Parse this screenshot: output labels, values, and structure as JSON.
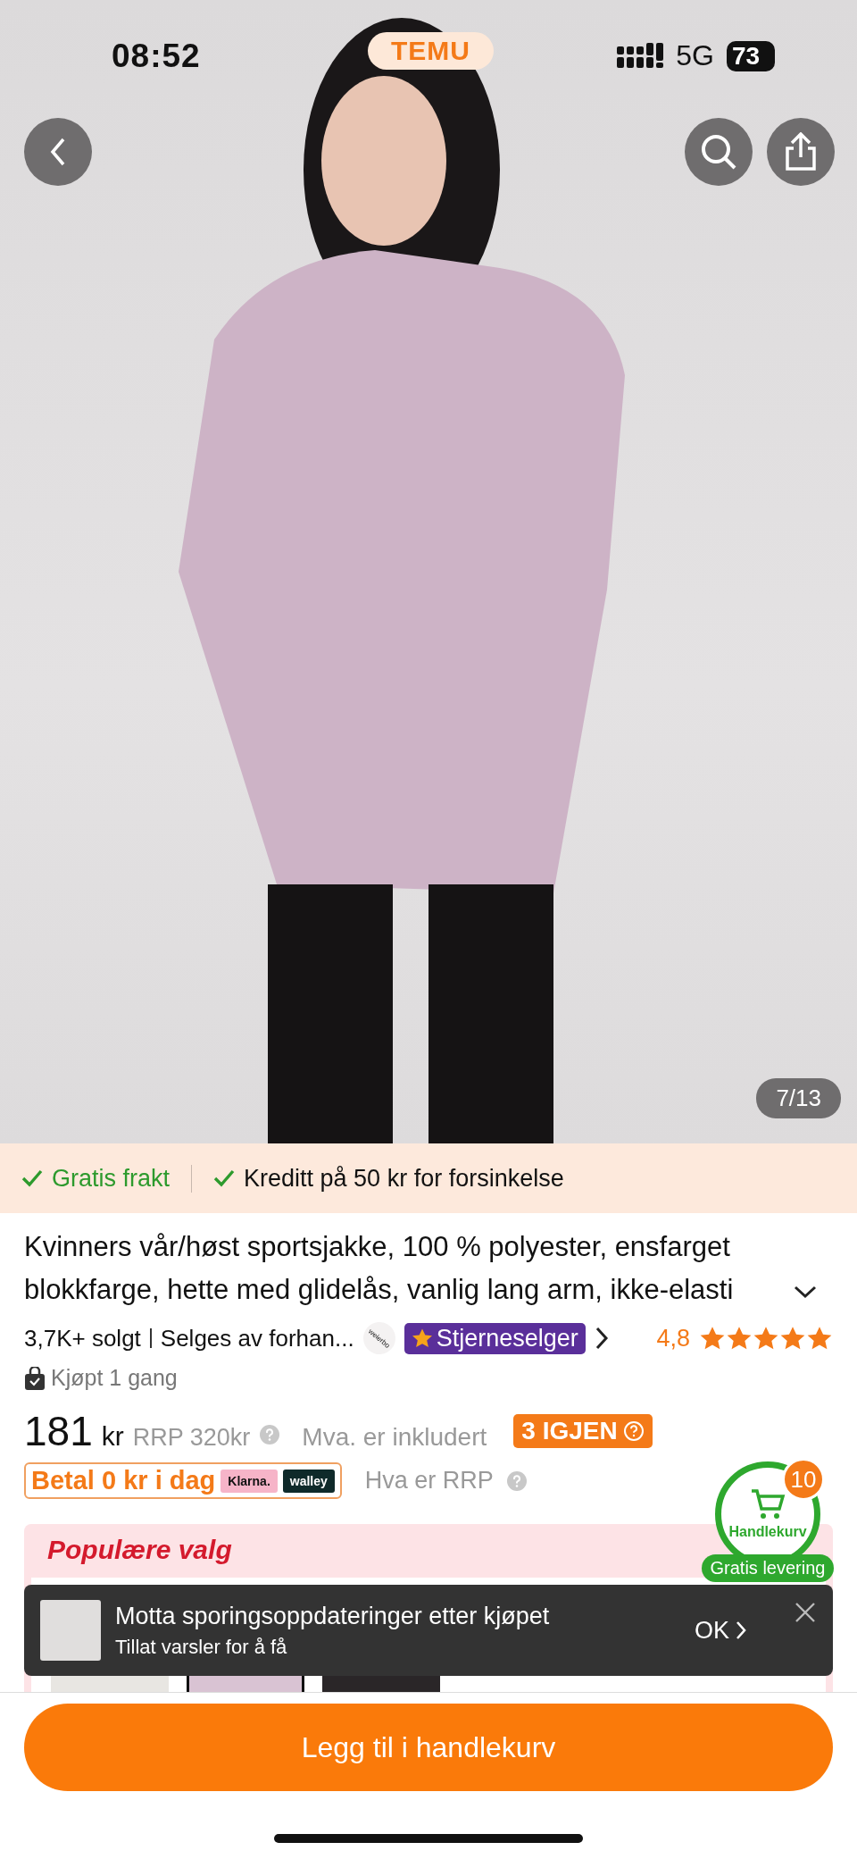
{
  "status_bar": {
    "time": "08:52",
    "app_badge": "TEMU",
    "network": "5G",
    "battery": "73"
  },
  "gallery": {
    "counter": "7/13"
  },
  "benefits": [
    {
      "label": "Gratis frakt",
      "kind": "highlight"
    },
    {
      "label": "Kreditt på 50 kr for forsinkelse",
      "kind": "plain"
    }
  ],
  "product": {
    "title": "Kvinners vår/høst sportsjakke, 100 % polyester, ensfarget blokkfarge, hette med glidelås, vanlig lang arm, ikke-elasti",
    "expanded": false,
    "sold": "3,7K+ solgt",
    "seller": "Selges av forhan...",
    "seller_logo": "weierbo",
    "seller_badge": "Stjerneselger",
    "rating": "4,8",
    "stars": 5,
    "purchased": "Kjøpt 1 gang",
    "price": "181",
    "currency": "kr",
    "rrp": "RRP 320kr",
    "vat": "Mva. er inkludert",
    "stock_badge": "3 IGJEN",
    "pay_later": "Betal 0 kr i dag",
    "pay_providers": [
      {
        "label": "Klarna.",
        "color": "#f6b4c8"
      },
      {
        "label": "walley",
        "color": "#0f2a2a"
      }
    ],
    "rrp_help": "Hva er RRP"
  },
  "popular": {
    "title": "Populære valg",
    "variants": [
      {
        "selected": false,
        "color": "#e8e6e2"
      },
      {
        "selected": true,
        "color": "#d9c3d3"
      },
      {
        "selected": false,
        "color": "#2a2628"
      }
    ]
  },
  "cart": {
    "count": "10",
    "label": "Handlekurv",
    "delivery": "Gratis levering"
  },
  "toast": {
    "title": "Motta sporingsoppdateringer etter kjøpet",
    "subtitle": "Tillat varsler for å få",
    "action": "OK"
  },
  "add_to_cart": "Legg til i handlekurv"
}
